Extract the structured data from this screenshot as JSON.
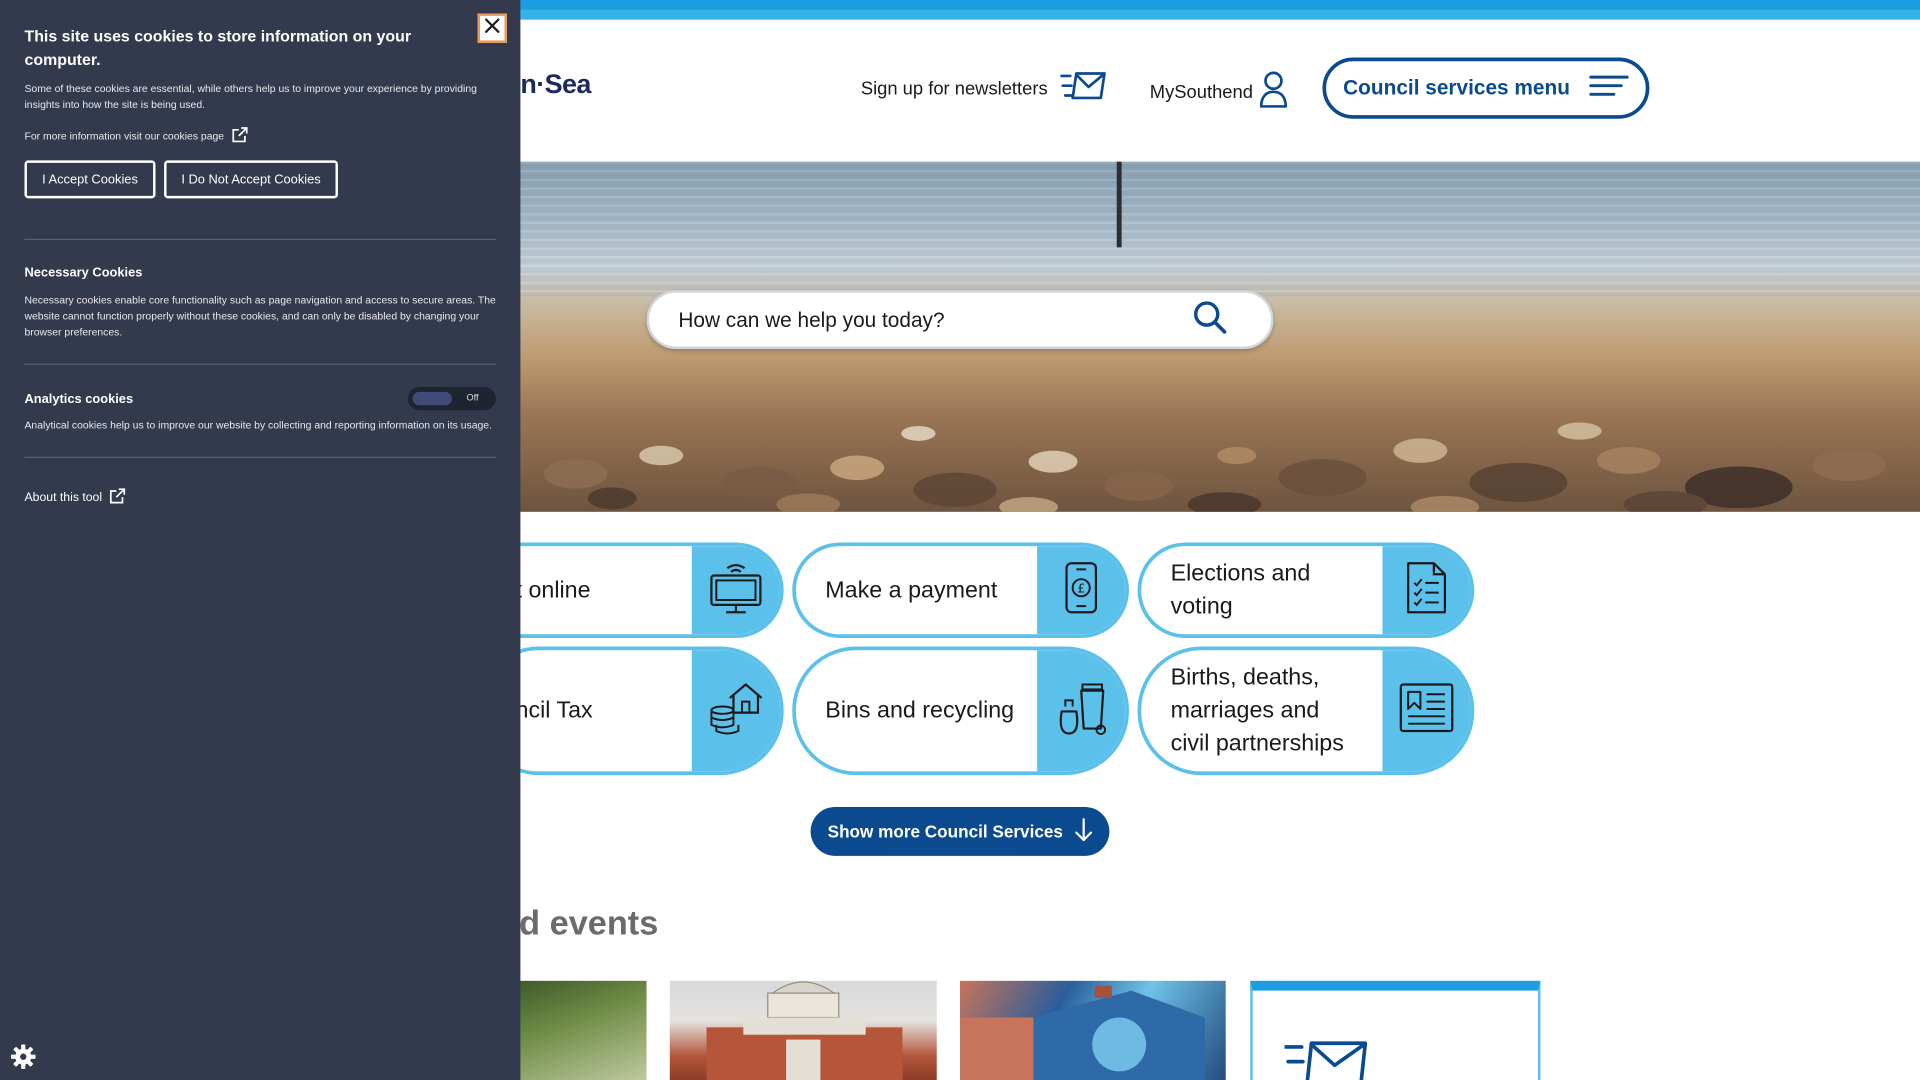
{
  "header": {
    "logo_fragment": "n·Sea",
    "newsletter_label": "Sign up for newsletters",
    "mysouthend_label": "MySouthend",
    "menu_button_label": "Council services menu"
  },
  "search": {
    "placeholder": "How can we help you today?"
  },
  "services": [
    {
      "label": "t online",
      "icon": "computer-monitor-icon"
    },
    {
      "label": "Make a payment",
      "icon": "phone-pound-icon"
    },
    {
      "label": "Elections and voting",
      "icon": "checklist-document-icon"
    },
    {
      "label": "ncil Tax",
      "icon": "house-coins-icon"
    },
    {
      "label": "Bins and recycling",
      "icon": "bins-icon"
    },
    {
      "label": "Births, deaths, marriages and civil partnerships",
      "icon": "certificate-document-icon"
    }
  ],
  "show_more_label": "Show more Council Services",
  "events_title_fragment": "d events",
  "cookie_panel": {
    "title": "This site uses cookies to store information on your computer.",
    "intro": "Some of these cookies are essential, while others help us to improve your experience by providing insights into how the site is being used.",
    "more_info": "For more information visit our cookies page",
    "accept_label": "I Accept Cookies",
    "reject_label": "I Do Not Accept Cookies",
    "necessary_heading": "Necessary Cookies",
    "necessary_text": "Necessary cookies enable core functionality such as page navigation and access to secure areas. The website cannot function properly without these cookies, and can only be disabled by changing your browser preferences.",
    "analytics_heading": "Analytics cookies",
    "analytics_toggle_state": "Off",
    "analytics_text": "Analytical cookies help us to improve our website by collecting and reporting information on its usage.",
    "about_label": "About this tool"
  },
  "colors": {
    "brand_dark": "#0b4a8f",
    "brand_light": "#5bc0ea",
    "top_bar": "#1d9ee3",
    "cookie_bg": "#333a4d"
  }
}
